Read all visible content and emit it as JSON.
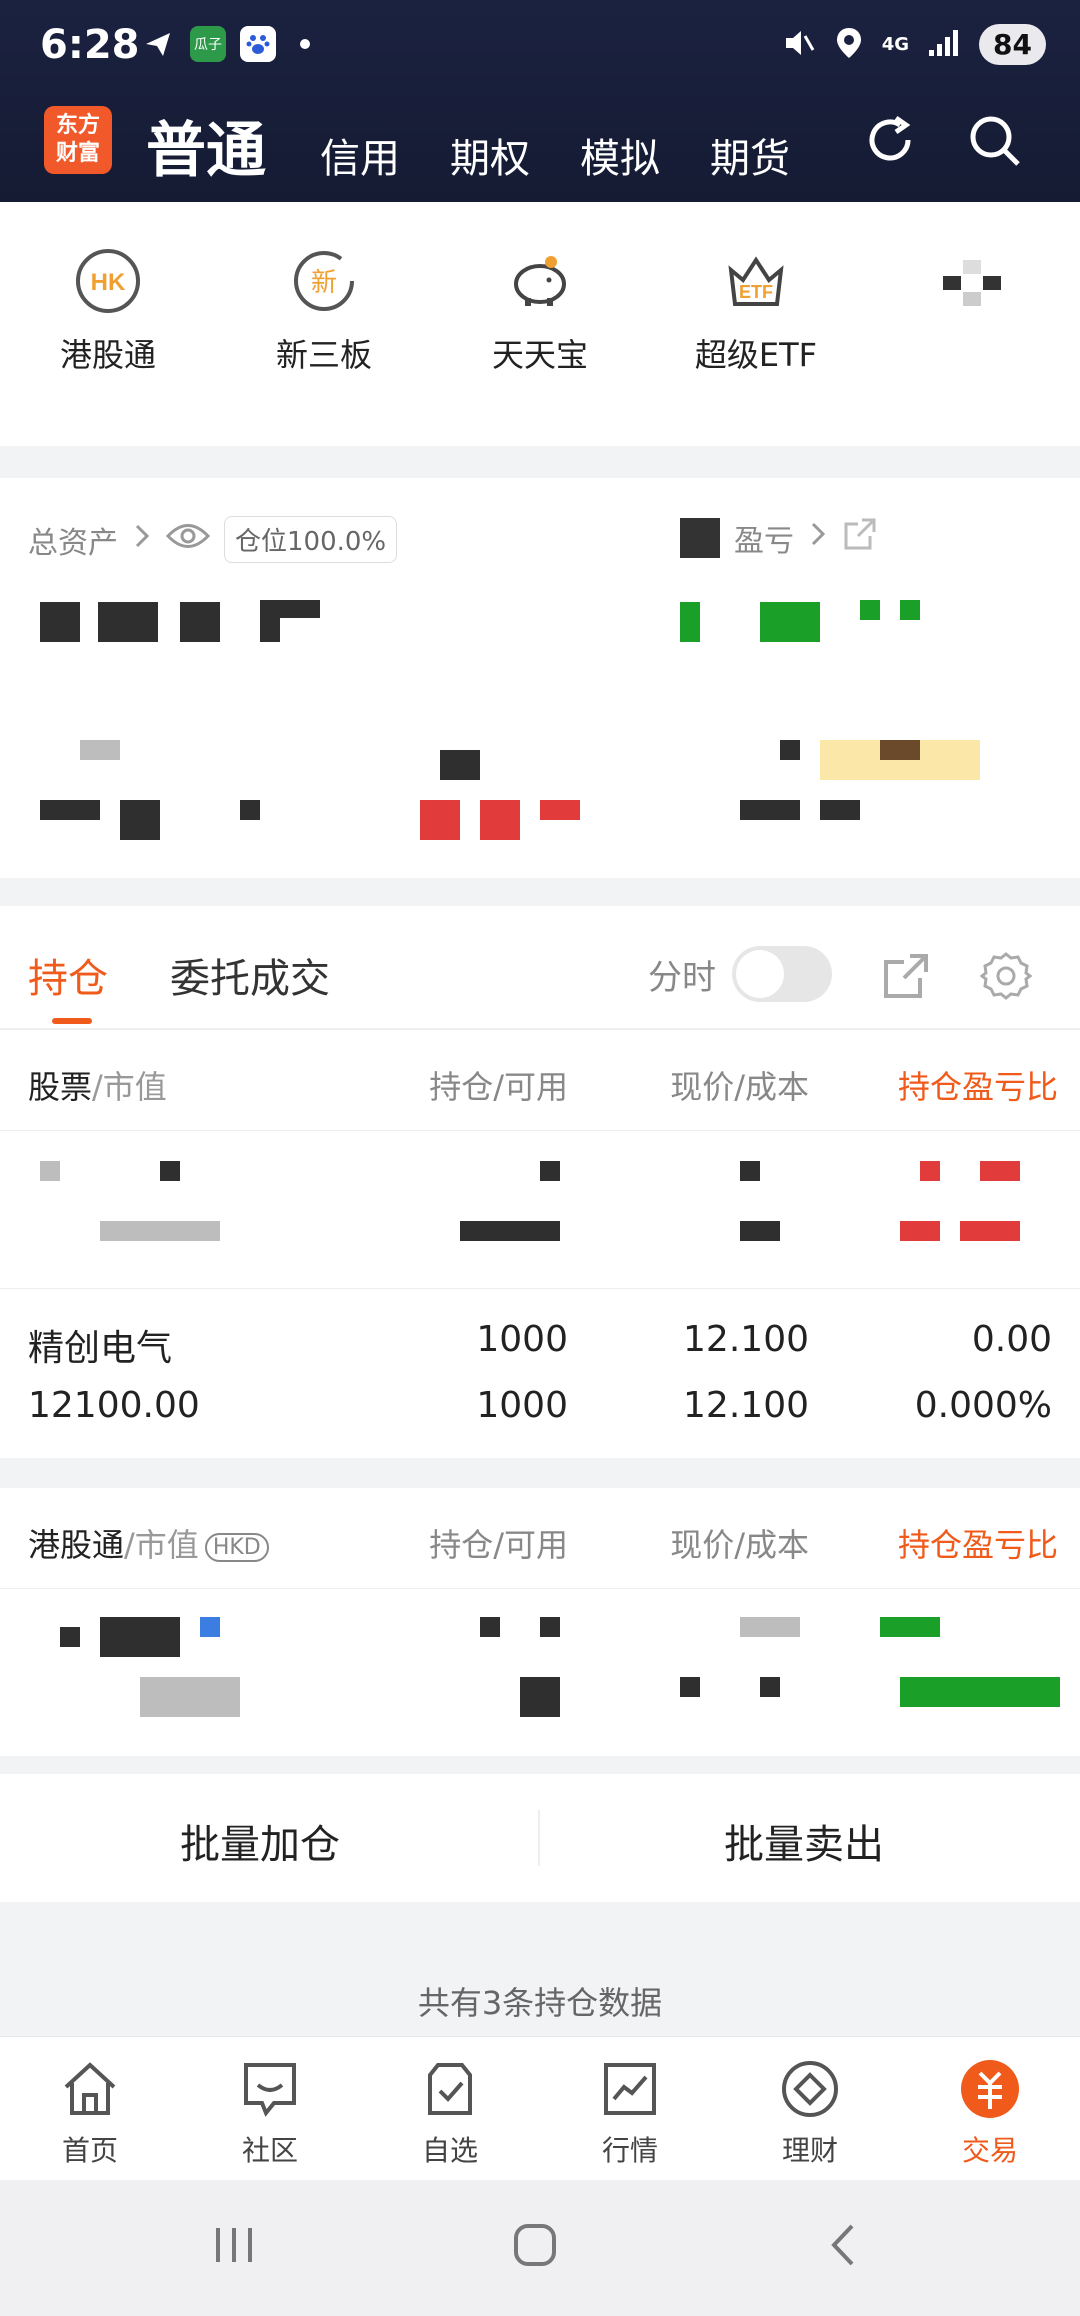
{
  "status_bar": {
    "time": "6:28",
    "battery": "84",
    "app_badge": "瓜子",
    "network": "4G"
  },
  "header": {
    "logo_text": "东方\n财富",
    "tabs": [
      "普通",
      "信用",
      "期权",
      "模拟",
      "期货"
    ]
  },
  "quick_services": [
    {
      "label": "港股通",
      "icon": "hk-icon"
    },
    {
      "label": "新三板",
      "icon": "new-board-icon"
    },
    {
      "label": "天天宝",
      "icon": "piggy-bank-icon"
    },
    {
      "label": "超级ETF",
      "icon": "etf-icon"
    },
    {
      "label": "",
      "icon": "more-icon"
    }
  ],
  "asset": {
    "total_label": "总资产",
    "position_badge": "仓位100.0%",
    "pnl_label": "盈亏"
  },
  "holdings": {
    "tabs": [
      "持仓",
      "委托成交"
    ],
    "time_share_label": "分时",
    "a_share_header": {
      "c1": "股票",
      "c1_sub": "/市值",
      "c2": "持仓/可用",
      "c3": "现价/成本",
      "c4": "持仓盈亏比"
    },
    "rows": [
      {
        "name": "精创电气",
        "market_value": "12100.00",
        "hold": "1000",
        "available": "1000",
        "price": "12.100",
        "cost": "12.100",
        "pnl": "0.00",
        "pnl_ratio": "0.000%"
      }
    ],
    "hk_header": {
      "c1": "港股通",
      "c1_sub": "/市值",
      "currency": "HKD",
      "c2": "持仓/可用",
      "c3": "现价/成本",
      "c4": "持仓盈亏比"
    }
  },
  "batch": {
    "add": "批量加仓",
    "sell": "批量卖出"
  },
  "summary_count": "共有3条持仓数据",
  "bottom_nav": [
    "首页",
    "社区",
    "自选",
    "行情",
    "理财",
    "交易"
  ],
  "colors": {
    "accent": "#f05a1a",
    "header_bg": "#1b2240",
    "up": "#e23b3b",
    "down": "#1aa028"
  }
}
